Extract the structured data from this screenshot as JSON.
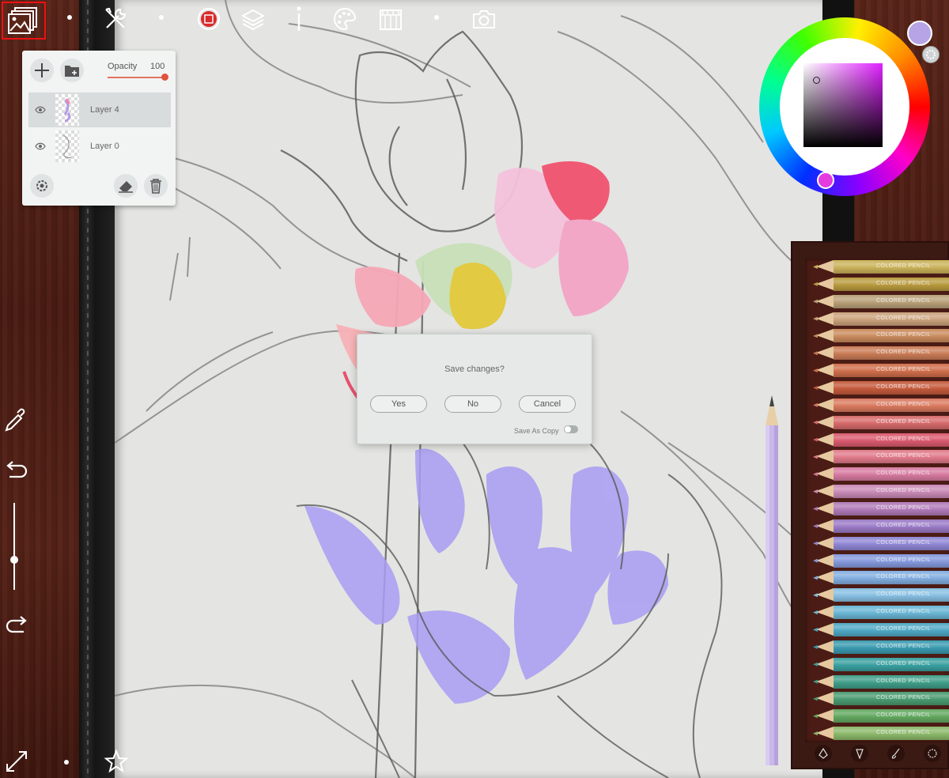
{
  "layers_panel": {
    "opacity_label": "Opacity",
    "opacity_value": "100",
    "opacity_fraction": 1.0,
    "layers": [
      {
        "name": "Layer 4",
        "selected": true
      },
      {
        "name": "Layer 0",
        "selected": false
      }
    ]
  },
  "dialog": {
    "question": "Save changes?",
    "yes": "Yes",
    "no": "No",
    "cancel": "Cancel",
    "save_as_copy": "Save As Copy"
  },
  "colors": {
    "current": "#b6a4e6",
    "hue_cursor": "#e33be0",
    "paper": "#e4e4e2",
    "accent_red": "#e11111"
  },
  "pencil_box": {
    "label": "COLORED PENCIL",
    "colors": [
      "#c9b25a",
      "#b89a3e",
      "#b8a078",
      "#caa27c",
      "#c98a5c",
      "#c97b55",
      "#cf6e4b",
      "#c45a3c",
      "#d9795e",
      "#d66a6a",
      "#d95a6e",
      "#e07a8a",
      "#d67aa0",
      "#c98ab6",
      "#b07ab8",
      "#9a7ac6",
      "#8f86d4",
      "#8498dc",
      "#82aee0",
      "#86bfe2",
      "#6ab6d4",
      "#4fa8c4",
      "#3a9ab0",
      "#39a0a0",
      "#3f9e88",
      "#4a9a70",
      "#62a860",
      "#8bb86a"
    ]
  }
}
